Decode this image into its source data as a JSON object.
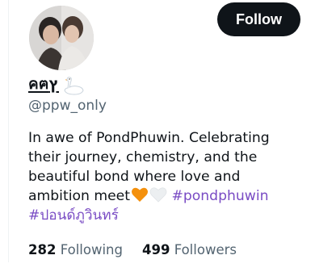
{
  "profile": {
    "display_name": "คฅץ",
    "handle": "@ppw_only",
    "follow_label": "Follow",
    "name_emoji": "swan-icon",
    "bio": {
      "line1": "In awe of PondPhuwin. Celebrating",
      "line2": "their journey, chemistry, and the",
      "line3": "beautiful bond where love and",
      "line4": "ambition meet",
      "hearts": [
        "orange-heart-icon",
        "white-heart-icon"
      ],
      "hashtag1": "#pondphuwin",
      "hashtag2": "#ปอนด์ภูวินทร์"
    },
    "stats": {
      "following_count": "282",
      "following_label": "Following",
      "followers_count": "499",
      "followers_label": "Followers"
    }
  },
  "colors": {
    "follow_bg": "#0f1419",
    "hashtag": "#794bc4",
    "muted": "#536471"
  }
}
